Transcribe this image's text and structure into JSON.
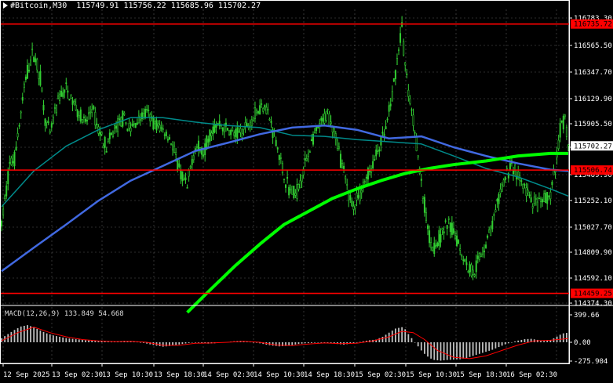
{
  "header": {
    "symbol": "#Bitcoin,M30",
    "ohlc": "115749.91 115756.22 115685.96 115702.27"
  },
  "macd": {
    "label": "MACD(12,26,9) 133.849 54.668",
    "axis_labels": [
      "399.66",
      "0.00",
      "-275.904"
    ],
    "axis_values": [
      399.66,
      0,
      -275.904
    ]
  },
  "colors": {
    "background": "#000000",
    "candle": "#32cd32",
    "ma_fast": "#008b8b",
    "ma_mid": "#4169e1",
    "ma_slow": "#00ff00",
    "hline": "#ff0000",
    "macd_hist": "#c0c0c0",
    "macd_signal": "#ff0000",
    "grid": "#c0c0c0"
  },
  "chart_data": {
    "type": "candlestick",
    "title": "#Bitcoin,M30",
    "y_axis": {
      "ticks": [
        116783.3,
        116565.5,
        116347.7,
        116129.9,
        115905.5,
        115689.7,
        115469.9,
        115252.1,
        115027.7,
        114809.9,
        114592.1,
        114374.3
      ],
      "tick_labels": [
        "116783.30",
        "116565.50",
        "116347.70",
        "116129.90",
        "115905.50",
        "115689.70",
        "115469.90",
        "115252.10",
        "115027.70",
        "114809.90",
        "114592.10",
        "114374.30"
      ],
      "ylim": [
        114374.3,
        116783.3
      ]
    },
    "x_axis": {
      "tick_labels": [
        "12 Sep 2025",
        "13 Sep 02:30",
        "13 Sep 10:30",
        "13 Sep 18:30",
        "14 Sep 02:30",
        "14 Sep 10:30",
        "14 Sep 18:30",
        "15 Sep 02:30",
        "15 Sep 10:30",
        "15 Sep 18:30",
        "16 Sep 02:30"
      ]
    },
    "current_price": {
      "value": 115702.27,
      "label": "115702.27"
    },
    "horizontal_lines": [
      {
        "value": 116735.72,
        "label": "116735.72"
      },
      {
        "value": 115506.74,
        "label": "115506.74"
      },
      {
        "value": 114459.25,
        "label": "114459.25"
      }
    ],
    "grid": true,
    "price_path": [
      [
        0,
        115050
      ],
      [
        3,
        115350
      ],
      [
        5,
        115550
      ],
      [
        8,
        115600
      ],
      [
        10,
        115800
      ],
      [
        13,
        116100
      ],
      [
        15,
        116300
      ],
      [
        18,
        116450
      ],
      [
        20,
        116500
      ],
      [
        24,
        116300
      ],
      [
        27,
        115950
      ],
      [
        30,
        115800
      ],
      [
        33,
        116000
      ],
      [
        36,
        116150
      ],
      [
        40,
        116200
      ],
      [
        44,
        116100
      ],
      [
        48,
        116000
      ],
      [
        52,
        115900
      ],
      [
        56,
        116050
      ],
      [
        60,
        115850
      ],
      [
        65,
        115700
      ],
      [
        70,
        115850
      ],
      [
        75,
        115950
      ],
      [
        80,
        115850
      ],
      [
        85,
        115950
      ],
      [
        90,
        116000
      ],
      [
        95,
        115900
      ],
      [
        100,
        115850
      ],
      [
        105,
        115750
      ],
      [
        110,
        115500
      ],
      [
        115,
        115350
      ],
      [
        118,
        115600
      ],
      [
        120,
        115700
      ],
      [
        125,
        115650
      ],
      [
        130,
        115850
      ],
      [
        135,
        115900
      ],
      [
        140,
        115850
      ],
      [
        145,
        115800
      ],
      [
        150,
        115850
      ],
      [
        155,
        115950
      ],
      [
        160,
        116050
      ],
      [
        163,
        116100
      ],
      [
        166,
        115950
      ],
      [
        170,
        115750
      ],
      [
        174,
        115500
      ],
      [
        178,
        115350
      ],
      [
        182,
        115300
      ],
      [
        186,
        115450
      ],
      [
        190,
        115650
      ],
      [
        194,
        115800
      ],
      [
        198,
        115900
      ],
      [
        202,
        116000
      ],
      [
        206,
        115850
      ],
      [
        210,
        115600
      ],
      [
        214,
        115350
      ],
      [
        218,
        115200
      ],
      [
        222,
        115300
      ],
      [
        226,
        115450
      ],
      [
        230,
        115550
      ],
      [
        234,
        115700
      ],
      [
        238,
        115850
      ],
      [
        242,
        116150
      ],
      [
        246,
        116550
      ],
      [
        248,
        116700
      ],
      [
        250,
        116400
      ],
      [
        253,
        116100
      ],
      [
        256,
        115850
      ],
      [
        259,
        115500
      ],
      [
        262,
        115200
      ],
      [
        265,
        114950
      ],
      [
        268,
        114850
      ],
      [
        272,
        114950
      ],
      [
        276,
        115050
      ],
      [
        280,
        115000
      ],
      [
        284,
        114850
      ],
      [
        288,
        114700
      ],
      [
        292,
        114650
      ],
      [
        296,
        114750
      ],
      [
        300,
        114900
      ],
      [
        304,
        115050
      ],
      [
        308,
        115250
      ],
      [
        312,
        115450
      ],
      [
        316,
        115550
      ],
      [
        320,
        115450
      ],
      [
        324,
        115350
      ],
      [
        328,
        115250
      ],
      [
        332,
        115200
      ],
      [
        336,
        115250
      ],
      [
        340,
        115300
      ],
      [
        343,
        115500
      ],
      [
        346,
        115850
      ],
      [
        349,
        115950
      ],
      [
        351,
        115700
      ]
    ],
    "ma_fast": [
      [
        0,
        115200
      ],
      [
        20,
        115500
      ],
      [
        40,
        115700
      ],
      [
        60,
        115850
      ],
      [
        80,
        115960
      ],
      [
        100,
        115960
      ],
      [
        120,
        115920
      ],
      [
        140,
        115890
      ],
      [
        160,
        115870
      ],
      [
        180,
        115800
      ],
      [
        200,
        115790
      ],
      [
        220,
        115760
      ],
      [
        240,
        115740
      ],
      [
        260,
        115720
      ],
      [
        280,
        115620
      ],
      [
        300,
        115520
      ],
      [
        320,
        115450
      ],
      [
        340,
        115350
      ],
      [
        351,
        115290
      ]
    ],
    "ma_mid": [
      [
        0,
        114650
      ],
      [
        20,
        114850
      ],
      [
        40,
        115050
      ],
      [
        60,
        115250
      ],
      [
        80,
        115420
      ],
      [
        100,
        115540
      ],
      [
        120,
        115660
      ],
      [
        140,
        115730
      ],
      [
        160,
        115810
      ],
      [
        180,
        115870
      ],
      [
        200,
        115890
      ],
      [
        220,
        115850
      ],
      [
        240,
        115770
      ],
      [
        260,
        115790
      ],
      [
        280,
        115690
      ],
      [
        300,
        115620
      ],
      [
        320,
        115560
      ],
      [
        340,
        115510
      ],
      [
        351,
        115500
      ]
    ],
    "ma_slow": [
      [
        115,
        114300
      ],
      [
        130,
        114500
      ],
      [
        145,
        114700
      ],
      [
        160,
        114880
      ],
      [
        175,
        115050
      ],
      [
        190,
        115160
      ],
      [
        205,
        115270
      ],
      [
        220,
        115350
      ],
      [
        235,
        115420
      ],
      [
        250,
        115480
      ],
      [
        265,
        115520
      ],
      [
        280,
        115550
      ],
      [
        300,
        115580
      ],
      [
        320,
        115620
      ],
      [
        340,
        115640
      ],
      [
        351,
        115640
      ]
    ],
    "macd_hist": [
      [
        0,
        60
      ],
      [
        4,
        120
      ],
      [
        8,
        180
      ],
      [
        12,
        230
      ],
      [
        16,
        250
      ],
      [
        20,
        220
      ],
      [
        24,
        170
      ],
      [
        28,
        130
      ],
      [
        32,
        100
      ],
      [
        36,
        80
      ],
      [
        40,
        60
      ],
      [
        44,
        50
      ],
      [
        48,
        40
      ],
      [
        52,
        30
      ],
      [
        56,
        25
      ],
      [
        60,
        20
      ],
      [
        64,
        15
      ],
      [
        68,
        5
      ],
      [
        72,
        10
      ],
      [
        76,
        20
      ],
      [
        80,
        15
      ],
      [
        84,
        5
      ],
      [
        88,
        -10
      ],
      [
        92,
        -30
      ],
      [
        96,
        -50
      ],
      [
        100,
        -65
      ],
      [
        104,
        -55
      ],
      [
        108,
        -40
      ],
      [
        112,
        -25
      ],
      [
        116,
        -10
      ],
      [
        120,
        0
      ],
      [
        124,
        -10
      ],
      [
        128,
        -20
      ],
      [
        132,
        -15
      ],
      [
        136,
        -5
      ],
      [
        140,
        5
      ],
      [
        144,
        15
      ],
      [
        148,
        20
      ],
      [
        152,
        10
      ],
      [
        156,
        0
      ],
      [
        160,
        -15
      ],
      [
        164,
        -35
      ],
      [
        168,
        -50
      ],
      [
        172,
        -60
      ],
      [
        176,
        -55
      ],
      [
        180,
        -40
      ],
      [
        184,
        -25
      ],
      [
        188,
        -15
      ],
      [
        192,
        -10
      ],
      [
        196,
        -5
      ],
      [
        200,
        0
      ],
      [
        204,
        -10
      ],
      [
        208,
        -25
      ],
      [
        212,
        -35
      ],
      [
        216,
        -20
      ],
      [
        220,
        -5
      ],
      [
        224,
        15
      ],
      [
        228,
        30
      ],
      [
        232,
        40
      ],
      [
        236,
        80
      ],
      [
        240,
        140
      ],
      [
        244,
        200
      ],
      [
        248,
        220
      ],
      [
        250,
        190
      ],
      [
        252,
        120
      ],
      [
        254,
        60
      ],
      [
        256,
        0
      ],
      [
        258,
        -60
      ],
      [
        260,
        -120
      ],
      [
        262,
        -170
      ],
      [
        264,
        -210
      ],
      [
        266,
        -240
      ],
      [
        268,
        -260
      ],
      [
        272,
        -270
      ],
      [
        276,
        -260
      ],
      [
        280,
        -255
      ],
      [
        284,
        -250
      ],
      [
        288,
        -230
      ],
      [
        292,
        -200
      ],
      [
        296,
        -170
      ],
      [
        300,
        -140
      ],
      [
        304,
        -110
      ],
      [
        308,
        -70
      ],
      [
        312,
        -30
      ],
      [
        316,
        0
      ],
      [
        320,
        25
      ],
      [
        324,
        45
      ],
      [
        328,
        50
      ],
      [
        332,
        35
      ],
      [
        336,
        20
      ],
      [
        340,
        30
      ],
      [
        343,
        70
      ],
      [
        346,
        110
      ],
      [
        349,
        140
      ],
      [
        351,
        134
      ]
    ],
    "macd_signal": [
      [
        0,
        20
      ],
      [
        10,
        140
      ],
      [
        20,
        220
      ],
      [
        30,
        140
      ],
      [
        40,
        80
      ],
      [
        50,
        40
      ],
      [
        60,
        20
      ],
      [
        70,
        10
      ],
      [
        80,
        15
      ],
      [
        90,
        0
      ],
      [
        100,
        -45
      ],
      [
        110,
        -45
      ],
      [
        120,
        -15
      ],
      [
        130,
        -10
      ],
      [
        140,
        0
      ],
      [
        150,
        15
      ],
      [
        160,
        0
      ],
      [
        170,
        -40
      ],
      [
        180,
        -50
      ],
      [
        190,
        -25
      ],
      [
        200,
        -10
      ],
      [
        210,
        -20
      ],
      [
        220,
        -15
      ],
      [
        230,
        20
      ],
      [
        240,
        80
      ],
      [
        248,
        160
      ],
      [
        255,
        140
      ],
      [
        262,
        40
      ],
      [
        270,
        -120
      ],
      [
        280,
        -220
      ],
      [
        290,
        -240
      ],
      [
        300,
        -200
      ],
      [
        310,
        -120
      ],
      [
        320,
        -40
      ],
      [
        330,
        20
      ],
      [
        340,
        30
      ],
      [
        351,
        55
      ]
    ]
  }
}
